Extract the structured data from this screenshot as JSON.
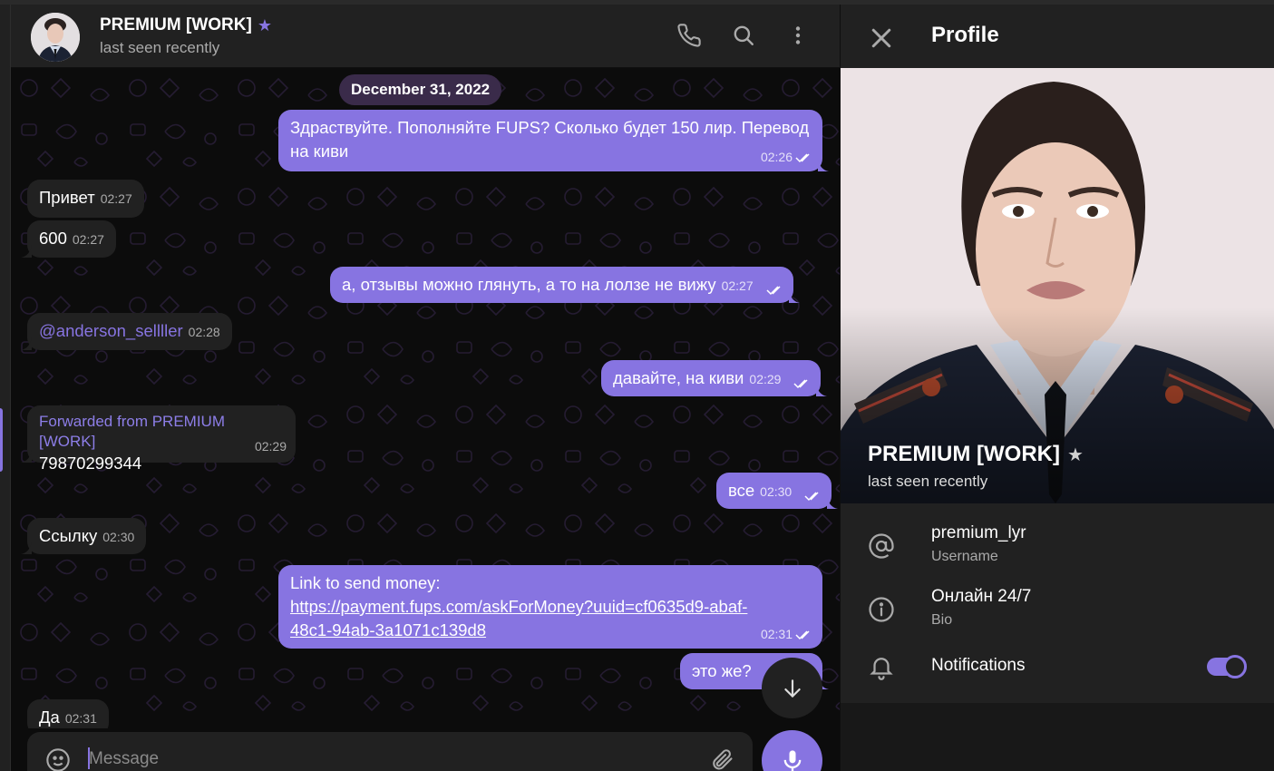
{
  "header": {
    "name": "PREMIUM [WORK]",
    "status": "last seen recently"
  },
  "date_separator": "December 31, 2022",
  "messages": [
    {
      "text": "Здраствуйте. Пополняйте FUPS? Сколько будет 150 лир. Перевод на киви",
      "time": "02:26",
      "dir": "out"
    },
    {
      "text": "Привет",
      "time": "02:27",
      "dir": "in"
    },
    {
      "text": "600",
      "time": "02:27",
      "dir": "in"
    },
    {
      "text": "а, отзывы можно глянуть, а то на лолзе  не вижу",
      "time": "02:27",
      "dir": "out"
    },
    {
      "text": "@anderson_sellller",
      "time": "02:28",
      "dir": "in"
    },
    {
      "text": "давайте, на киви",
      "time": "02:29",
      "dir": "out"
    },
    {
      "forwarded_from": "Forwarded from PREMIUM [WORK]",
      "text": "79870299344",
      "time": "02:29",
      "dir": "in"
    },
    {
      "text": "все",
      "time": "02:30",
      "dir": "out"
    },
    {
      "text": "Ссылку",
      "time": "02:30",
      "dir": "in"
    },
    {
      "label": "Link to send money:",
      "link_line1": "https://payment.fups.com/askForMoney?uuid=cf0635d9-abaf-",
      "link_line2": "48c1-94ab-3a1071c139d8",
      "time": "02:31",
      "dir": "out"
    },
    {
      "text": "это же?",
      "time": "",
      "dir": "out"
    },
    {
      "text": "Да",
      "time": "02:31",
      "dir": "in"
    }
  ],
  "composer": {
    "placeholder": "Message"
  },
  "profile": {
    "title": "Profile",
    "name": "PREMIUM [WORK]",
    "status": "last seen recently",
    "username": "premium_lyr",
    "username_label": "Username",
    "bio": "Онлайн 24/7",
    "bio_label": "Bio",
    "notifications_label": "Notifications",
    "notifications_on": true
  },
  "colors": {
    "accent": "#8774e1",
    "panel": "#212121",
    "background": "#0f0f0f"
  }
}
